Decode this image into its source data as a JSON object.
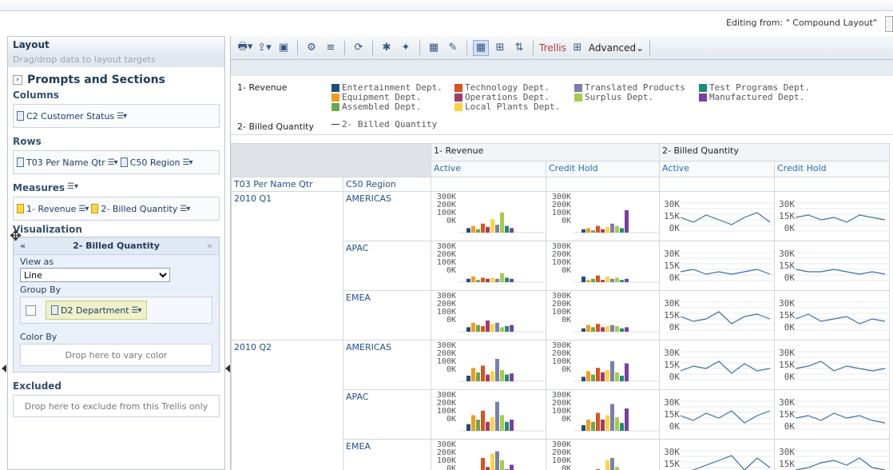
{
  "header": {
    "editing": "Editing from: \" Compound Layout\""
  },
  "layout": {
    "title": "Layout",
    "subtitle": "Drag/drop data to layout targets",
    "prompts": "Prompts and Sections",
    "columns_label": "Columns",
    "columns_item": "C2 Customer Status",
    "rows_label": "Rows",
    "rows_items": [
      "T03 Per Name Qtr",
      "C50 Region"
    ],
    "measures_label": "Measures",
    "measures_items": [
      "1- Revenue",
      "2- Billed Quantity"
    ],
    "viz_label": "Visualization",
    "viz_title": "2- Billed Quantity",
    "view_as_label": "View as",
    "view_as_value": "Line",
    "group_by_label": "Group By",
    "group_by_item": "D2 Department",
    "color_by_label": "Color By",
    "color_by_drop": "Drop here to vary color",
    "excluded_label": "Excluded",
    "excluded_drop": "Drop here to exclude from this Trellis only"
  },
  "toolbar": {
    "trellis": "Trellis",
    "advanced": "Advanced"
  },
  "legend": {
    "revenue_label": "1- Revenue",
    "billed_label": "2- Billed Quantity",
    "billed_series": "2- Billed Quantity",
    "depts": [
      {
        "name": "Entertainment Dept.",
        "color": "#1f4e79"
      },
      {
        "name": "Equipment Dept.",
        "color": "#f59b1c"
      },
      {
        "name": "Assembled Dept.",
        "color": "#6aa84f"
      },
      {
        "name": "Technology Dept.",
        "color": "#d9531e"
      },
      {
        "name": "Operations Dept.",
        "color": "#a23b6b"
      },
      {
        "name": "Local Plants Dept.",
        "color": "#ffd33d"
      },
      {
        "name": "Translated Products",
        "color": "#7a7fb0"
      },
      {
        "name": "Surplus Dept.",
        "color": "#a6cc4a"
      },
      {
        "name": "Test Programs Dept.",
        "color": "#1f8c7a"
      },
      {
        "name": "Manufactured Dept.",
        "color": "#7b3fa0"
      }
    ]
  },
  "table": {
    "col_groups": [
      "1- Revenue",
      "2- Billed Quantity"
    ],
    "statuses": [
      "Active",
      "Credit Hold",
      "Active",
      "Credit Hold"
    ],
    "row_hdr1": "T03 Per Name Qtr",
    "row_hdr2": "C50 Region",
    "rev_ticks": [
      "300K",
      "200K",
      "100K",
      "0K"
    ],
    "qty_ticks": [
      "30K",
      "15K",
      "0K"
    ],
    "quarters": [
      "2010 Q1",
      "2010 Q2"
    ],
    "regions": [
      "AMERICAS",
      "APAC",
      "EMEA"
    ]
  }
}
